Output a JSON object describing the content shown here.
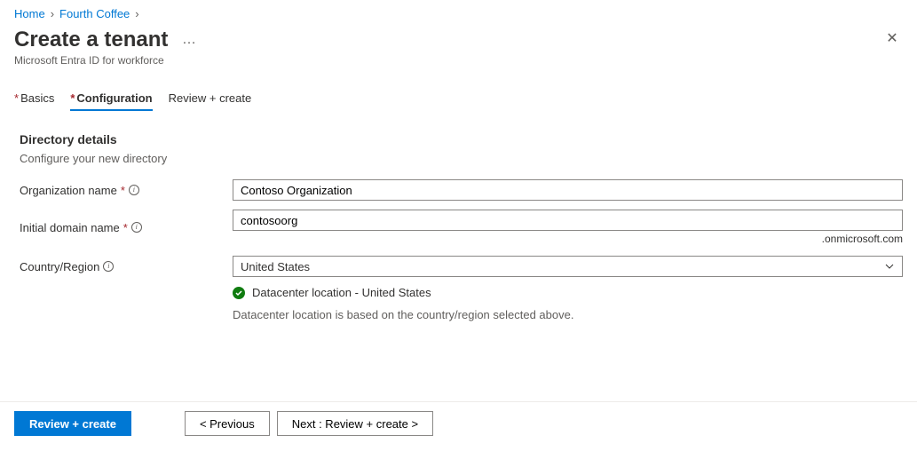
{
  "breadcrumb": {
    "home": "Home",
    "current": "Fourth Coffee"
  },
  "header": {
    "title": "Create a tenant",
    "subtitle": "Microsoft Entra ID for workforce"
  },
  "tabs": {
    "basics": "Basics",
    "configuration": "Configuration",
    "review": "Review + create"
  },
  "section": {
    "title": "Directory details",
    "desc": "Configure your new directory"
  },
  "form": {
    "org_label": "Organization name",
    "org_value": "Contoso Organization",
    "domain_label": "Initial domain name",
    "domain_value": "contosoorg",
    "domain_suffix": ".onmicrosoft.com",
    "country_label": "Country/Region",
    "country_value": "United States",
    "datacenter_ok": "Datacenter location - United States",
    "datacenter_note": "Datacenter location is based on the country/region selected above."
  },
  "footer": {
    "review": "Review + create",
    "previous": "< Previous",
    "next": "Next : Review + create >"
  }
}
